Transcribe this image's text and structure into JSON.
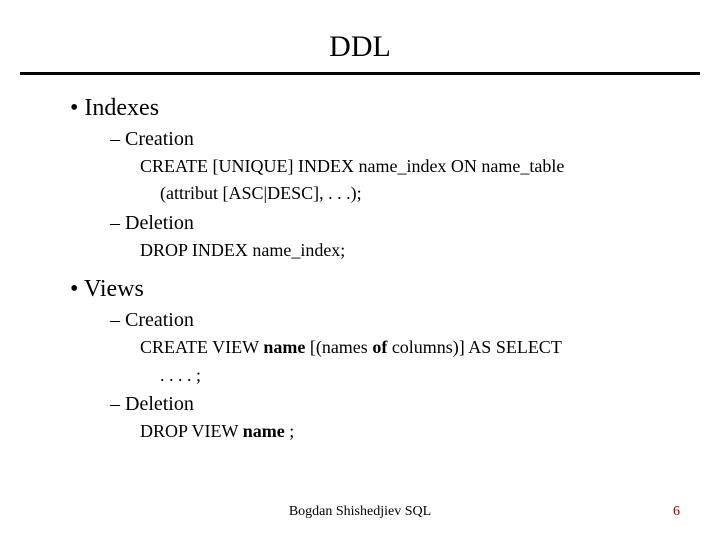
{
  "title": "DDL",
  "sections": [
    {
      "heading": "Indexes",
      "items": [
        {
          "label": "Creation",
          "code_line1": "CREATE [UNIQUE] INDEX name_index ON name_table",
          "code_line2": "(attribut [ASC|DESC], . . .);"
        },
        {
          "label": "Deletion",
          "code_line1": "DROP INDEX name_index;"
        }
      ]
    },
    {
      "heading": "Views",
      "items": [
        {
          "label": "Creation",
          "code_prefix": "CREATE VIEW ",
          "code_bold1": "name",
          "code_mid": " [(names ",
          "code_bold2": "of ",
          "code_suffix": "columns)] AS SELECT",
          "code_line2": ". . . . ;"
        },
        {
          "label": "Deletion",
          "code_prefix": "DROP VIEW ",
          "code_bold1": "name",
          "code_suffix": " ;"
        }
      ]
    }
  ],
  "footer": {
    "author": "Bogdan Shishedjiev SQL",
    "page": "6"
  }
}
